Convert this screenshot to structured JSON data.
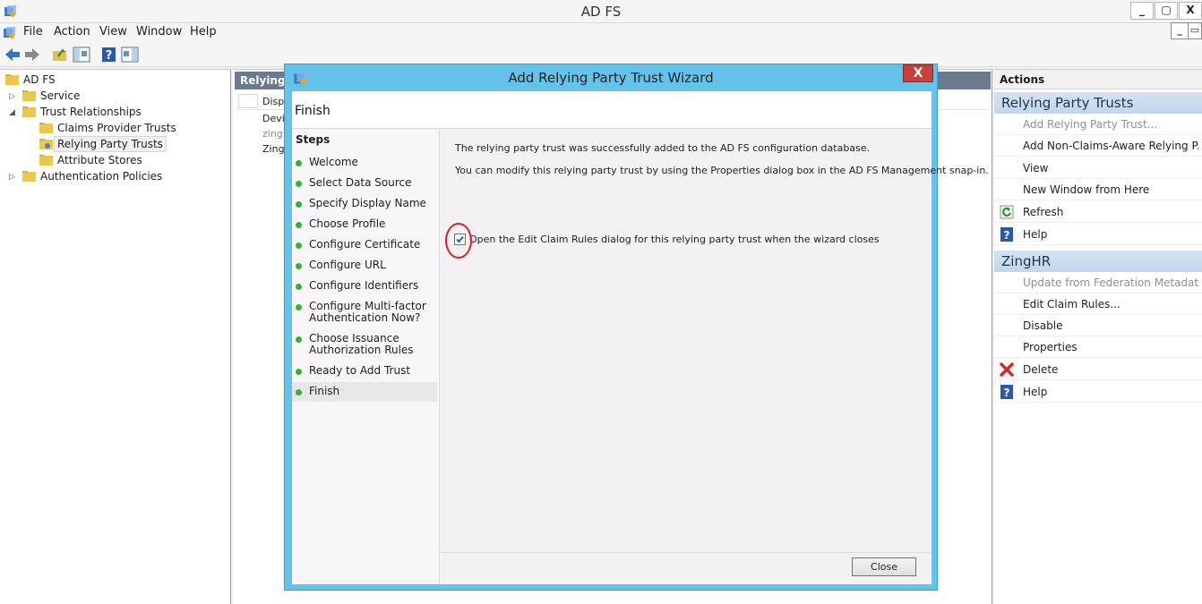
{
  "window": {
    "title": "AD FS",
    "min": "_",
    "max": "▢",
    "close": "X",
    "child_min": "_",
    "child_restore": "▭"
  },
  "menu": [
    "File",
    "Action",
    "View",
    "Window",
    "Help"
  ],
  "tree": {
    "root": "AD FS",
    "service": "Service",
    "trust_relationships": "Trust Relationships",
    "claims_provider_trusts": "Claims Provider Trusts",
    "relying_party_trusts": "Relying Party Trusts",
    "attribute_stores": "Attribute Stores",
    "authentication_policies": "Authentication Policies"
  },
  "center": {
    "header": "Relying P",
    "col": "Displ",
    "rows": [
      "Devic",
      "zing ...",
      "Zingl"
    ]
  },
  "actions": {
    "header": "Actions",
    "section1": "Relying Party Trusts",
    "items1": [
      {
        "label": "Add Relying Party Trust...",
        "enabled": false
      },
      {
        "label": "Add Non-Claims-Aware Relying P...",
        "enabled": true
      },
      {
        "label": "View",
        "enabled": true
      },
      {
        "label": "New Window from Here",
        "enabled": true
      },
      {
        "label": "Refresh",
        "enabled": true,
        "icon": "refresh-icon"
      },
      {
        "label": "Help",
        "enabled": true,
        "icon": "help-icon"
      }
    ],
    "section2": "ZingHR",
    "items2": [
      {
        "label": "Update from Federation Metadata...",
        "enabled": false
      },
      {
        "label": "Edit Claim Rules...",
        "enabled": true
      },
      {
        "label": "Disable",
        "enabled": true
      },
      {
        "label": "Properties",
        "enabled": true
      },
      {
        "label": "Delete",
        "enabled": true,
        "icon": "delete-icon"
      },
      {
        "label": "Help",
        "enabled": true,
        "icon": "help-icon"
      }
    ]
  },
  "dialog": {
    "title": "Add Relying Party Trust Wizard",
    "close": "X",
    "page_title": "Finish",
    "steps_header": "Steps",
    "steps": [
      "Welcome",
      "Select Data Source",
      "Specify Display Name",
      "Choose Profile",
      "Configure Certificate",
      "Configure URL",
      "Configure Identifiers",
      "Configure Multi-factor\nAuthentication Now?",
      "Choose Issuance\nAuthorization Rules",
      "Ready to Add Trust",
      "Finish"
    ],
    "current_step": "Finish",
    "message1": "The relying party trust was successfully added to the AD FS configuration database.",
    "message2": "You can modify this relying party trust by using the Properties dialog box in the AD FS Management snap-in.",
    "checkbox_label": "Open the Edit Claim Rules dialog for this relying party trust when the wizard closes",
    "checkbox_checked": true,
    "close_button": "Close"
  },
  "colors": {
    "dialog_frame": "#64c2eb",
    "close_red": "#c7403a",
    "step_dot": "#34b134",
    "annotation_circle": "#d8202a",
    "section_header": "#c9dcef"
  }
}
